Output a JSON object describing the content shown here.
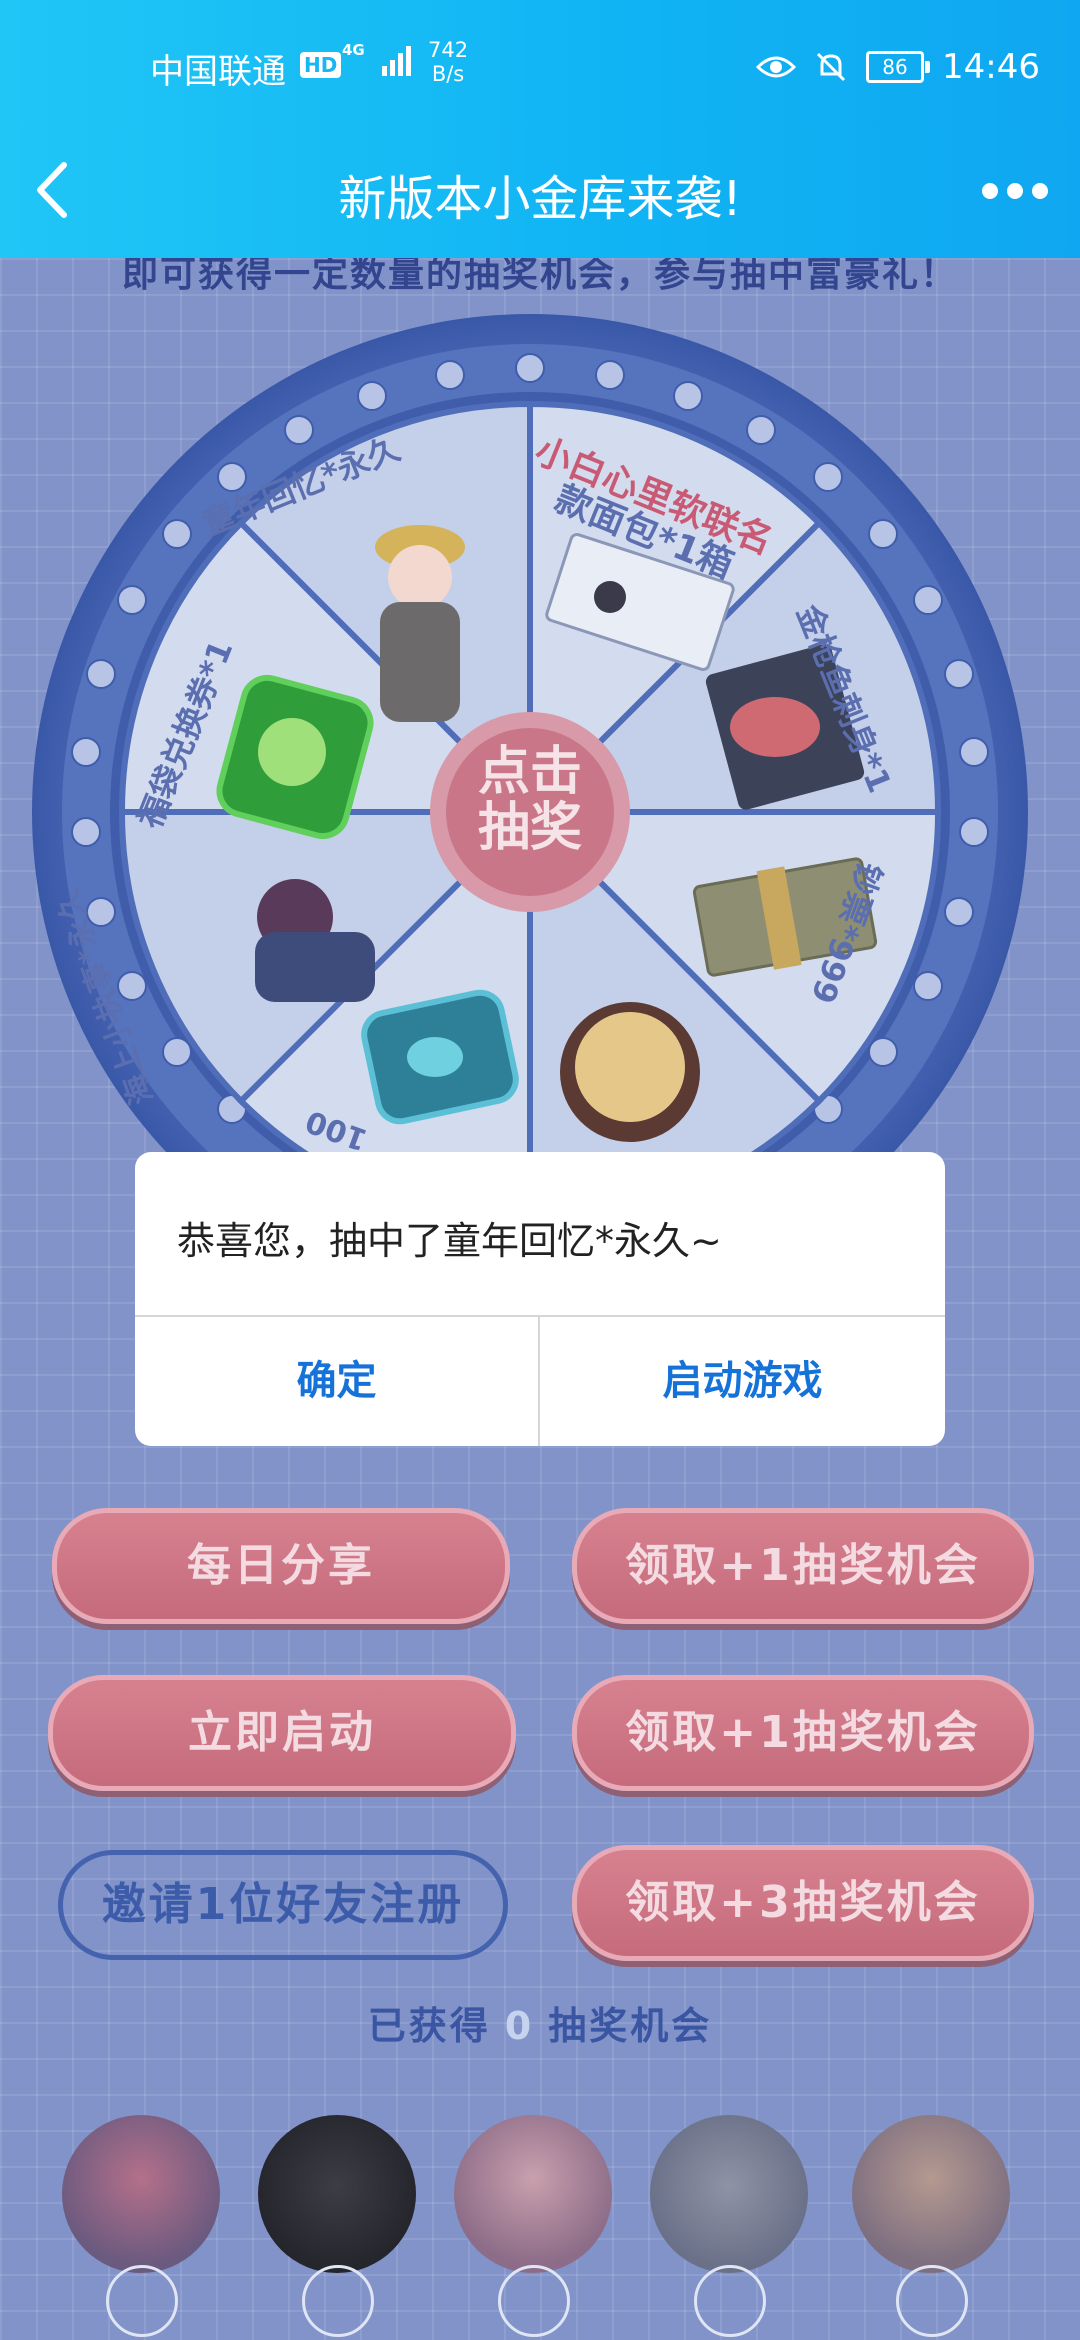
{
  "status_bar": {
    "carrier": "中国联通",
    "hd": "HD",
    "network": "4G",
    "speed_value": "742",
    "speed_unit": "B/s",
    "battery": "86",
    "time": "14:46"
  },
  "header": {
    "title": "新版本小金库来袭!",
    "back_icon": "chevron-left-icon",
    "more_icon": "more-dots-icon"
  },
  "subtitle": "即可获得一定数量的抽奖机会，参与抽中富豪礼！",
  "wheel": {
    "center_line1": "点击",
    "center_line2": "抽奖",
    "prizes": [
      "小白心里软联名",
      "款面包*1箱",
      "金枪鱼刺身*1",
      "钞票*999",
      "童年回忆*永久",
      "福袋兑换券*1",
      "海上小执事*永久",
      "100"
    ]
  },
  "dialog": {
    "message": "恭喜您，抽中了童年回忆*永久~",
    "confirm": "确定",
    "launch": "启动游戏"
  },
  "actions": {
    "daily_share": "每日分享",
    "claim1": "领取+1抽奖机会",
    "launch_now": "立即启动",
    "claim2": "领取+1抽奖机会",
    "invite": "邀请1位好友注册",
    "claim3": "领取+3抽奖机会"
  },
  "gained": {
    "prefix": "已获得",
    "count": "0",
    "suffix": "抽奖机会"
  },
  "colors": {
    "header_start": "#20c6f6",
    "header_end": "#0fa7f1",
    "pill_button": "#c56b7c",
    "dialog_button": "#1572d8",
    "wheel_rim": "#4f6db8"
  }
}
